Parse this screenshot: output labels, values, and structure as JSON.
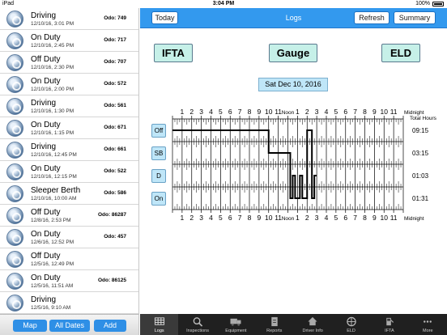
{
  "status": {
    "device": "iPad",
    "time": "3:04 PM",
    "battery": "100%"
  },
  "logs": [
    {
      "status": "Driving",
      "datetime": "12/10/16, 3:01 PM",
      "odo": "Odo: 749"
    },
    {
      "status": "On Duty",
      "datetime": "12/10/16, 2:45 PM",
      "odo": "Odo: 717"
    },
    {
      "status": "Off Duty",
      "datetime": "12/10/16, 2:30 PM",
      "odo": "Odo: 707"
    },
    {
      "status": "On Duty",
      "datetime": "12/10/16, 2:00 PM",
      "odo": "Odo: 572"
    },
    {
      "status": "Driving",
      "datetime": "12/10/16, 1:30 PM",
      "odo": "Odo: 561"
    },
    {
      "status": "On Duty",
      "datetime": "12/10/16, 1:15 PM",
      "odo": "Odo: 671"
    },
    {
      "status": "Driving",
      "datetime": "12/10/16, 12:45 PM",
      "odo": "Odo: 661"
    },
    {
      "status": "On Duty",
      "datetime": "12/10/16, 12:15 PM",
      "odo": "Odo: 522"
    },
    {
      "status": "Sleeper Berth",
      "datetime": "12/10/16, 10:00 AM",
      "odo": "Odo: 586"
    },
    {
      "status": "Off Duty",
      "datetime": "12/8/16, 2:53 PM",
      "odo": "Odo: 86287"
    },
    {
      "status": "On Duty",
      "datetime": "12/6/16, 12:52 PM",
      "odo": "Odo: 457"
    },
    {
      "status": "Off Duty",
      "datetime": "12/5/16, 12:49 PM",
      "odo": ""
    },
    {
      "status": "On Duty",
      "datetime": "12/5/16, 11:51 AM",
      "odo": "Odo: 86125"
    },
    {
      "status": "Driving",
      "datetime": "12/5/16, 9:10 AM",
      "odo": ""
    }
  ],
  "left_toolbar": {
    "map": "Map",
    "all_dates": "All Dates",
    "add": "Add"
  },
  "header": {
    "title": "Logs",
    "today": "Today",
    "refresh": "Refresh",
    "summary": "Summary"
  },
  "modes": {
    "ifta": "IFTA",
    "gauge": "Gauge",
    "eld": "ELD"
  },
  "date_label": "Sat Dec 10, 2016",
  "chart_data": {
    "type": "line",
    "hour_labels_top": [
      "1",
      "2",
      "3",
      "4",
      "5",
      "6",
      "7",
      "8",
      "9",
      "10",
      "11",
      "Noon",
      "1",
      "2",
      "3",
      "4",
      "5",
      "6",
      "7",
      "8",
      "9",
      "10",
      "11",
      "Midnight"
    ],
    "hour_labels_bottom": [
      "1",
      "2",
      "3",
      "4",
      "5",
      "6",
      "7",
      "8",
      "9",
      "10",
      "11",
      "Noon",
      "1",
      "2",
      "3",
      "4",
      "5",
      "6",
      "7",
      "8",
      "9",
      "10",
      "11",
      "Midnight"
    ],
    "total_hours_label": "Total Hours",
    "rows": [
      {
        "label": "Off",
        "total": "09:15"
      },
      {
        "label": "SB",
        "total": "03:15"
      },
      {
        "label": "D",
        "total": "01:03"
      },
      {
        "label": "On",
        "total": "01:31"
      }
    ],
    "segments": [
      {
        "row": 0,
        "start": 0,
        "end": 10
      },
      {
        "row": 1,
        "start": 10,
        "end": 12.25
      },
      {
        "row": 3,
        "start": 12.25,
        "end": 12.5
      },
      {
        "row": 2,
        "start": 12.5,
        "end": 12.75
      },
      {
        "row": 3,
        "start": 12.75,
        "end": 13.25
      },
      {
        "row": 2,
        "start": 13.25,
        "end": 13.5
      },
      {
        "row": 3,
        "start": 13.5,
        "end": 14
      },
      {
        "row": 0,
        "start": 14,
        "end": 14.5
      },
      {
        "row": 3,
        "start": 14.5,
        "end": 14.75
      },
      {
        "row": 2,
        "start": 14.75,
        "end": 15
      }
    ]
  },
  "tabs": [
    "Logs",
    "Inspections",
    "Equipment",
    "Reports",
    "Driver Info",
    "ELD",
    "IFTA",
    "More"
  ]
}
